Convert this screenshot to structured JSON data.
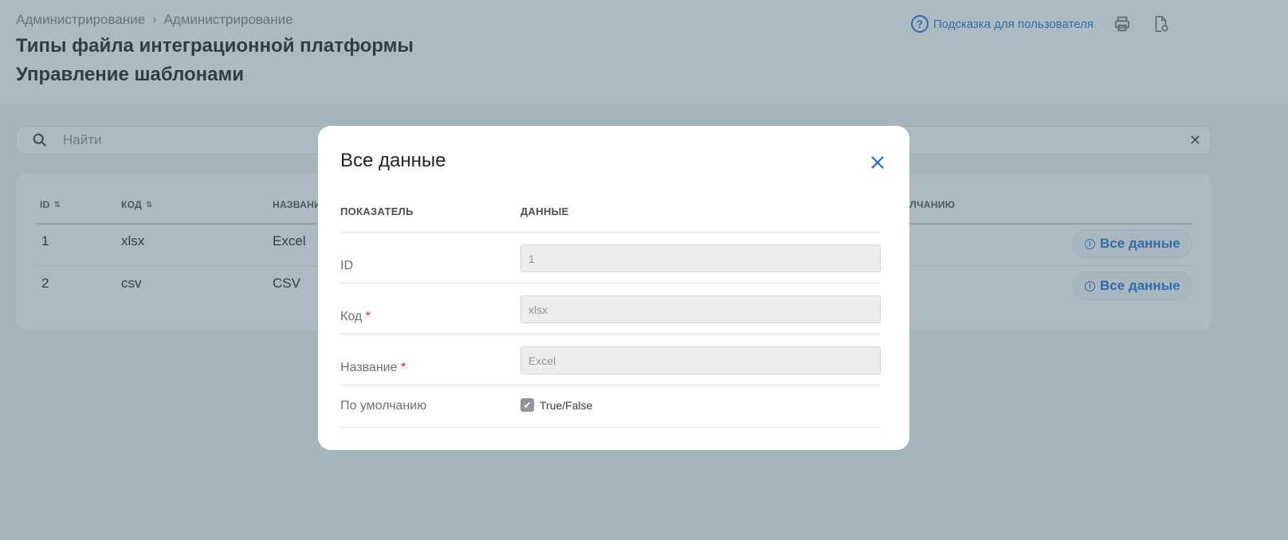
{
  "header": {
    "breadcrumb": [
      "Администрирование",
      "Администрирование"
    ],
    "title_line1": "Типы файла интеграционной платформы",
    "title_line2": "Управление шаблонами",
    "help_label": "Подсказка для пользователя",
    "help_icon": "question-circle-icon",
    "print_icon": "printer-icon",
    "export_icon": "document-refresh-icon"
  },
  "search": {
    "placeholder": "Найти",
    "clear_glyph": "✕"
  },
  "table": {
    "columns": [
      {
        "label": "ID",
        "sortable": true
      },
      {
        "label": "КОД",
        "sortable": true
      },
      {
        "label": "НАЗВАНИ"
      },
      {
        "label": "ОЛЧАНИЮ"
      }
    ],
    "rows": [
      {
        "id": "1",
        "code": "xlsx",
        "name": "Excel",
        "action": "Все данные"
      },
      {
        "id": "2",
        "code": "csv",
        "name": "CSV",
        "action": "Все данные"
      }
    ]
  },
  "modal": {
    "title": "Все данные",
    "col_indicator": "ПОКАЗАТЕЛЬ",
    "col_data": "ДАННЫЕ",
    "fields": [
      {
        "label": "ID",
        "required": false,
        "value": "1"
      },
      {
        "label": "Код",
        "required": true,
        "value": "xlsx"
      },
      {
        "label": "Название",
        "required": true,
        "value": "Excel"
      }
    ],
    "default_label": "По умолчанию",
    "default_checkbox_label": "True/False",
    "default_checked": true,
    "required_mark": "*"
  },
  "colors": {
    "accent": "#1f6fd1",
    "overlay": "#466878",
    "required": "#e02424"
  }
}
